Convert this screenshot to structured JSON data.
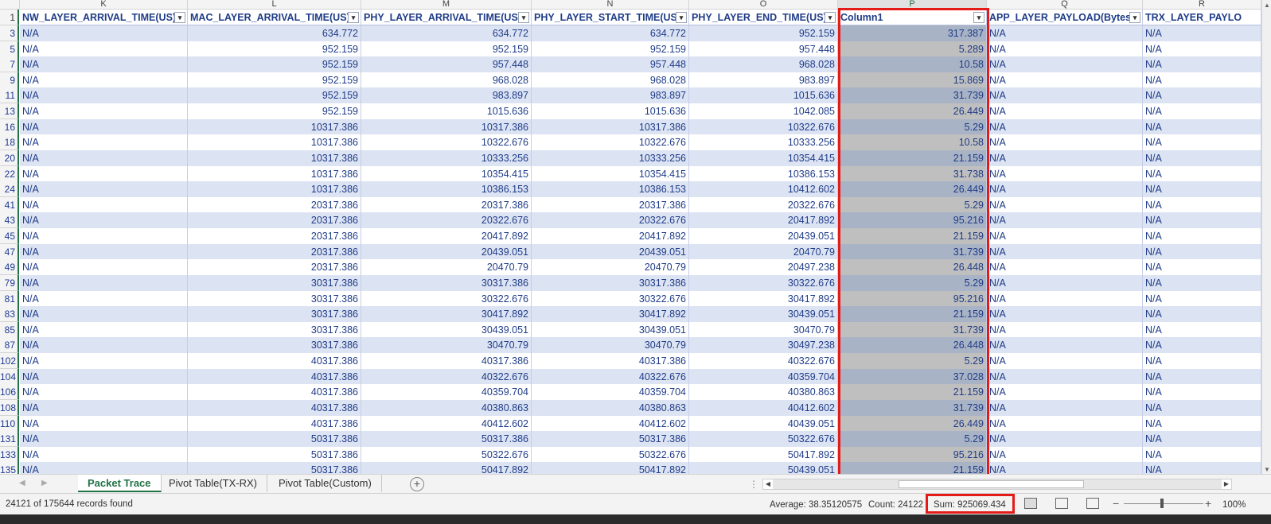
{
  "columns": [
    {
      "letter": "K",
      "header": "NW_LAYER_ARRIVAL_TIME(US)"
    },
    {
      "letter": "L",
      "header": "MAC_LAYER_ARRIVAL_TIME(US)"
    },
    {
      "letter": "M",
      "header": "PHY_LAYER_ARRIVAL_TIME(US)"
    },
    {
      "letter": "N",
      "header": "PHY_LAYER_START_TIME(US)"
    },
    {
      "letter": "O",
      "header": "PHY_LAYER_END_TIME(US)"
    },
    {
      "letter": "P",
      "header": "Column1"
    },
    {
      "letter": "Q",
      "header": "APP_LAYER_PAYLOAD(Bytes)"
    },
    {
      "letter": "R",
      "header": "TRX_LAYER_PAYLO"
    }
  ],
  "header_row_num": "1",
  "rows": [
    {
      "n": "3",
      "k": "N/A",
      "l": "634.772",
      "m": "634.772",
      "nn": "634.772",
      "o": "952.159",
      "p": "317.387",
      "q": "N/A",
      "r": "N/A"
    },
    {
      "n": "5",
      "k": "N/A",
      "l": "952.159",
      "m": "952.159",
      "nn": "952.159",
      "o": "957.448",
      "p": "5.289",
      "q": "N/A",
      "r": "N/A"
    },
    {
      "n": "7",
      "k": "N/A",
      "l": "952.159",
      "m": "957.448",
      "nn": "957.448",
      "o": "968.028",
      "p": "10.58",
      "q": "N/A",
      "r": "N/A"
    },
    {
      "n": "9",
      "k": "N/A",
      "l": "952.159",
      "m": "968.028",
      "nn": "968.028",
      "o": "983.897",
      "p": "15.869",
      "q": "N/A",
      "r": "N/A"
    },
    {
      "n": "11",
      "k": "N/A",
      "l": "952.159",
      "m": "983.897",
      "nn": "983.897",
      "o": "1015.636",
      "p": "31.739",
      "q": "N/A",
      "r": "N/A"
    },
    {
      "n": "13",
      "k": "N/A",
      "l": "952.159",
      "m": "1015.636",
      "nn": "1015.636",
      "o": "1042.085",
      "p": "26.449",
      "q": "N/A",
      "r": "N/A"
    },
    {
      "n": "16",
      "k": "N/A",
      "l": "10317.386",
      "m": "10317.386",
      "nn": "10317.386",
      "o": "10322.676",
      "p": "5.29",
      "q": "N/A",
      "r": "N/A"
    },
    {
      "n": "18",
      "k": "N/A",
      "l": "10317.386",
      "m": "10322.676",
      "nn": "10322.676",
      "o": "10333.256",
      "p": "10.58",
      "q": "N/A",
      "r": "N/A"
    },
    {
      "n": "20",
      "k": "N/A",
      "l": "10317.386",
      "m": "10333.256",
      "nn": "10333.256",
      "o": "10354.415",
      "p": "21.159",
      "q": "N/A",
      "r": "N/A"
    },
    {
      "n": "22",
      "k": "N/A",
      "l": "10317.386",
      "m": "10354.415",
      "nn": "10354.415",
      "o": "10386.153",
      "p": "31.738",
      "q": "N/A",
      "r": "N/A"
    },
    {
      "n": "24",
      "k": "N/A",
      "l": "10317.386",
      "m": "10386.153",
      "nn": "10386.153",
      "o": "10412.602",
      "p": "26.449",
      "q": "N/A",
      "r": "N/A"
    },
    {
      "n": "41",
      "k": "N/A",
      "l": "20317.386",
      "m": "20317.386",
      "nn": "20317.386",
      "o": "20322.676",
      "p": "5.29",
      "q": "N/A",
      "r": "N/A"
    },
    {
      "n": "43",
      "k": "N/A",
      "l": "20317.386",
      "m": "20322.676",
      "nn": "20322.676",
      "o": "20417.892",
      "p": "95.216",
      "q": "N/A",
      "r": "N/A"
    },
    {
      "n": "45",
      "k": "N/A",
      "l": "20317.386",
      "m": "20417.892",
      "nn": "20417.892",
      "o": "20439.051",
      "p": "21.159",
      "q": "N/A",
      "r": "N/A"
    },
    {
      "n": "47",
      "k": "N/A",
      "l": "20317.386",
      "m": "20439.051",
      "nn": "20439.051",
      "o": "20470.79",
      "p": "31.739",
      "q": "N/A",
      "r": "N/A"
    },
    {
      "n": "49",
      "k": "N/A",
      "l": "20317.386",
      "m": "20470.79",
      "nn": "20470.79",
      "o": "20497.238",
      "p": "26.448",
      "q": "N/A",
      "r": "N/A"
    },
    {
      "n": "79",
      "k": "N/A",
      "l": "30317.386",
      "m": "30317.386",
      "nn": "30317.386",
      "o": "30322.676",
      "p": "5.29",
      "q": "N/A",
      "r": "N/A"
    },
    {
      "n": "81",
      "k": "N/A",
      "l": "30317.386",
      "m": "30322.676",
      "nn": "30322.676",
      "o": "30417.892",
      "p": "95.216",
      "q": "N/A",
      "r": "N/A"
    },
    {
      "n": "83",
      "k": "N/A",
      "l": "30317.386",
      "m": "30417.892",
      "nn": "30417.892",
      "o": "30439.051",
      "p": "21.159",
      "q": "N/A",
      "r": "N/A"
    },
    {
      "n": "85",
      "k": "N/A",
      "l": "30317.386",
      "m": "30439.051",
      "nn": "30439.051",
      "o": "30470.79",
      "p": "31.739",
      "q": "N/A",
      "r": "N/A"
    },
    {
      "n": "87",
      "k": "N/A",
      "l": "30317.386",
      "m": "30470.79",
      "nn": "30470.79",
      "o": "30497.238",
      "p": "26.448",
      "q": "N/A",
      "r": "N/A"
    },
    {
      "n": "102",
      "k": "N/A",
      "l": "40317.386",
      "m": "40317.386",
      "nn": "40317.386",
      "o": "40322.676",
      "p": "5.29",
      "q": "N/A",
      "r": "N/A"
    },
    {
      "n": "104",
      "k": "N/A",
      "l": "40317.386",
      "m": "40322.676",
      "nn": "40322.676",
      "o": "40359.704",
      "p": "37.028",
      "q": "N/A",
      "r": "N/A"
    },
    {
      "n": "106",
      "k": "N/A",
      "l": "40317.386",
      "m": "40359.704",
      "nn": "40359.704",
      "o": "40380.863",
      "p": "21.159",
      "q": "N/A",
      "r": "N/A"
    },
    {
      "n": "108",
      "k": "N/A",
      "l": "40317.386",
      "m": "40380.863",
      "nn": "40380.863",
      "o": "40412.602",
      "p": "31.739",
      "q": "N/A",
      "r": "N/A"
    },
    {
      "n": "110",
      "k": "N/A",
      "l": "40317.386",
      "m": "40412.602",
      "nn": "40412.602",
      "o": "40439.051",
      "p": "26.449",
      "q": "N/A",
      "r": "N/A"
    },
    {
      "n": "131",
      "k": "N/A",
      "l": "50317.386",
      "m": "50317.386",
      "nn": "50317.386",
      "o": "50322.676",
      "p": "5.29",
      "q": "N/A",
      "r": "N/A"
    },
    {
      "n": "133",
      "k": "N/A",
      "l": "50317.386",
      "m": "50322.676",
      "nn": "50322.676",
      "o": "50417.892",
      "p": "95.216",
      "q": "N/A",
      "r": "N/A"
    },
    {
      "n": "135",
      "k": "N/A",
      "l": "50317.386",
      "m": "50417.892",
      "nn": "50417.892",
      "o": "50439.051",
      "p": "21.159",
      "q": "N/A",
      "r": "N/A"
    }
  ],
  "sheet_tabs": [
    {
      "label": "Packet Trace",
      "active": true
    },
    {
      "label": "Pivot Table(TX-RX)",
      "active": false
    },
    {
      "label": "Pivot Table(Custom)",
      "active": false
    }
  ],
  "status": {
    "records": "24121 of 175644 records found",
    "average": "Average: 38.35120575",
    "count": "Count: 24122",
    "sum": "Sum: 925069.434",
    "zoom": "100%"
  },
  "colors": {
    "accent": "#217346",
    "highlight": "#e41b17",
    "band": "#dce3f3",
    "text": "#1f3c88"
  }
}
